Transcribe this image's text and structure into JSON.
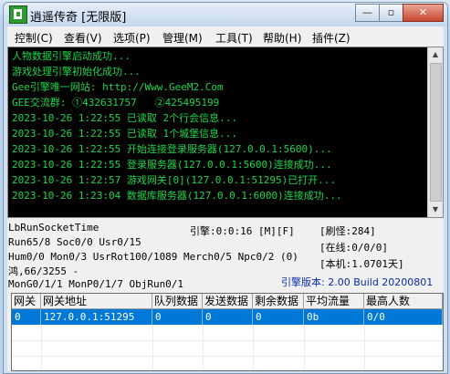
{
  "window": {
    "title": "逍遥传奇 [无限版]"
  },
  "titlebar_buttons": {
    "minimize": "—",
    "restore": "▫",
    "close": "✕"
  },
  "menu": [
    {
      "label": "控制(C)"
    },
    {
      "label": "查看(V)"
    },
    {
      "label": "选项(P)"
    },
    {
      "label": "管理(M)"
    },
    {
      "label": "工具(T)"
    },
    {
      "label": "帮助(H)"
    },
    {
      "label": "插件(Z)"
    }
  ],
  "console": {
    "lines": [
      "人物数据引擎启动成功...",
      "游戏处理引擎初始化成功...",
      "Gee引擎唯一网站: http://Www.GeeM2.Com",
      "GEE交流群: ①432631757   ②425495199",
      "2023-10-26 1:22:55 已读取 2个行会信息...",
      "2023-10-26 1:22:55 已读取 1个城堡信息...",
      "2023-10-26 1:22:55 开始连接登录服务器(127.0.0.1:5600)...",
      "2023-10-26 1:22:55 登录服务器(127.0.0.1:5600)连接成功...",
      "2023-10-26 1:22:57 游戏网关[0](127.0.0.1:51295)已打开...",
      "2023-10-26 1:23:04 数据库服务器(127.0.0.1:6000)连接成功..."
    ]
  },
  "status": {
    "socket": "LbRunSocketTime",
    "engine_time": "引擎:0:0:16 [M][F]",
    "radius": "[刷怪:284]",
    "run_stats": "Run65/8 Soc0/0 Usr0/15",
    "online": "[在线:0/0/0]",
    "counts": "Hum0/0 Mon0/3 UsrRot100/1089 Merch0/5 Npc0/2 (0)",
    "native": "[本机:1.0701天]",
    "misc": "鸿,66/3255 -",
    "monitor": "MonG0/1/1 MonP0/1/7 ObjRun0/1",
    "version": "引擎版本: 2.00 Build 20200801"
  },
  "grid": {
    "columns": [
      "网关",
      "网关地址",
      "队列数据",
      "发送数据",
      "剩余数据",
      "平均流量",
      "最高人数"
    ],
    "rows": [
      [
        "0",
        "127.0.0.1:51295",
        "0",
        "0",
        "0",
        "0b",
        "0/0"
      ]
    ]
  },
  "colors": {
    "console_bg": "#000000",
    "console_text": "#1cd64a",
    "selection": "#0078d7",
    "version_text": "#0b2ea8"
  }
}
